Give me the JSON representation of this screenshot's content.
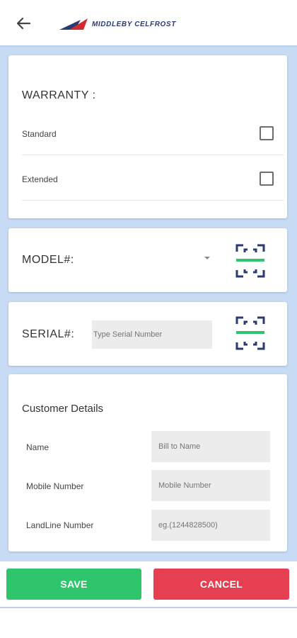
{
  "header": {
    "back_icon": "arrow-left-icon",
    "brand": "MIDDLEBY CELFROST",
    "brand_colors": {
      "mark_dark": "#2a3b72",
      "mark_red": "#d32a2f",
      "text": "#2a3b72"
    }
  },
  "warranty": {
    "title": "WARRANTY :",
    "options": [
      {
        "label": "Standard",
        "checked": false
      },
      {
        "label": "Extended",
        "checked": false
      }
    ]
  },
  "model": {
    "label": "MODEL#:",
    "selected_value": "",
    "scan_icon": "barcode-scan-icon"
  },
  "serial": {
    "label": "SERIAL#:",
    "placeholder": "Type Serial Number",
    "value": "",
    "scan_icon": "barcode-scan-icon"
  },
  "customer": {
    "title": "Customer Details",
    "fields": [
      {
        "label": "Name",
        "placeholder": "Bill to Name",
        "value": ""
      },
      {
        "label": "Mobile Number",
        "placeholder": "Mobile Number",
        "value": ""
      },
      {
        "label": "LandLine Number",
        "placeholder": "eg.(1244828500)",
        "value": ""
      }
    ]
  },
  "actions": {
    "save_label": "SAVE",
    "cancel_label": "CANCEL",
    "save_color": "#2fc56d",
    "cancel_color": "#e53f51"
  },
  "theme": {
    "background": "#c7dcf4",
    "scan_frame": "#2a3b72",
    "scan_line": "#2fc56d"
  }
}
